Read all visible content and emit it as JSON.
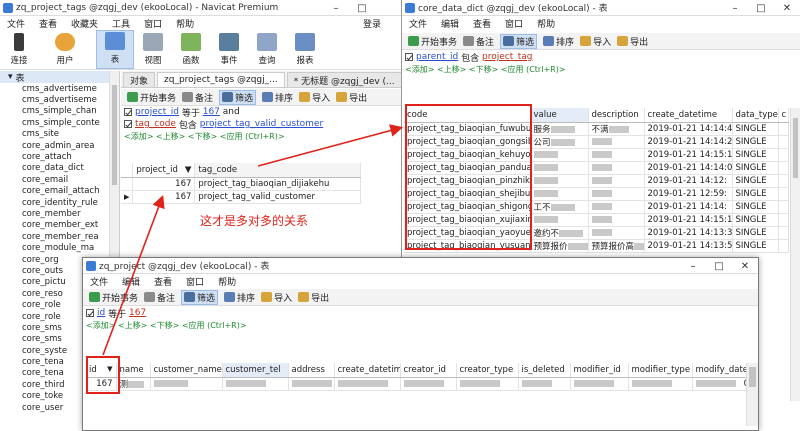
{
  "navicat": {
    "title": "zq_project_tags @zqgj_dev (ekooLocal) - Navicat Premium",
    "login": "登录",
    "menu": [
      "文件",
      "查看",
      "收藏夹",
      "工具",
      "窗口",
      "帮助"
    ],
    "tools": [
      "连接",
      "用户",
      "表",
      "视图",
      "函数",
      "事件",
      "查询",
      "报表"
    ],
    "sidebar_header": "表",
    "tree_items": [
      "cms_advertiseme",
      "cms_advertiseme",
      "cms_simple_chan",
      "cms_simple_conte",
      "cms_site",
      "core_admin_area",
      "core_attach",
      "core_data_dict",
      "core_email",
      "core_email_attach",
      "core_identity_rule",
      "core_member",
      "core_member_ext",
      "core_member_rea",
      "core_module_ma",
      "core_org",
      "core_outs",
      "core_pictu",
      "core_reso",
      "core_role",
      "core_role",
      "core_sms",
      "core_sms",
      "core_syste",
      "core_tena",
      "core_tena",
      "core_third",
      "core_toke",
      "core_user"
    ],
    "tabs": [
      "对象",
      "zq_project_tags @zqgj_...",
      "* 无标题 @zqgj_dev (..."
    ],
    "toolbar": [
      "开始事务",
      "备注",
      "筛选",
      "排序",
      "导入",
      "导出"
    ],
    "filter": {
      "field": "project_id",
      "op": "等于",
      "value": "167",
      "join": "and"
    },
    "filter2": {
      "field": "tag_code",
      "op": "包含",
      "value": "project_tag_valid_customer"
    },
    "hint": "<添加> <上移> <下移> <应用 (Ctrl+R)>",
    "columns": [
      "project_id",
      "tag_code"
    ],
    "rows": [
      [
        "167",
        "project_tag_biaoqian_dijiakehu"
      ],
      [
        "167",
        "project_tag_valid_customer"
      ]
    ],
    "annotation": "这才是多对多的关系"
  },
  "dict": {
    "title": "core_data_dict @zqgj_dev (ekooLocal) - 表",
    "menu": [
      "文件",
      "编辑",
      "查看",
      "窗口",
      "帮助"
    ],
    "toolbar": [
      "开始事务",
      "备注",
      "筛选",
      "排序",
      "导入",
      "导出"
    ],
    "filter": {
      "field": "parent_id",
      "op": "包含",
      "value": "project_tag"
    },
    "hint": "<添加> <上移> <下移> <应用 (Ctrl+R)>",
    "columns": [
      "code",
      "value",
      "description",
      "create_datetime",
      "data_type",
      "c"
    ],
    "codes": [
      "project_tag_biaoqian_fuwubumanyi",
      "project_tag_biaoqian_gongsibumanyi",
      "project_tag_biaoqian_kehuyouwenti",
      "project_tag_biaoqian_panduanbuzhun",
      "project_tag_biaoqian_pinzhikehu",
      "project_tag_biaoqian_shejibumanyi",
      "project_tag_biaoqian_shigongbuman",
      "project_tag_biaoqian_xujiaxinxi",
      "project_tag_biaoqian_yaoyuebujishi",
      "project_tag_biaoqian_yusuanbaojiag"
    ],
    "values": [
      "服务",
      "公司",
      "",
      "",
      "",
      "",
      "工不",
      "",
      "邀约不",
      "预算报价"
    ],
    "descriptions": [
      "不满",
      "",
      "",
      "",
      "",
      "",
      "",
      "",
      "",
      "预算报价高"
    ],
    "dates": [
      "2019-01-21 14:14:43",
      "2019-01-21 14:14:22",
      "2019-01-21 14:15:12",
      "2019-01-21 14:14:00",
      "2019-01-21 14:12:",
      "2019-01-21 12:59:",
      "2019-01-21 14:14:",
      "2019-01-21 14:15:18",
      "2019-01-21 14:13:32",
      "2019-01-21 14:13:52"
    ],
    "types": [
      "SINGLE",
      "SINGLE",
      "SINGLE",
      "SINGLE",
      "SINGLE",
      "SINGLE",
      "SINGLE",
      "SINGLE",
      "SINGLE",
      "SINGLE"
    ]
  },
  "proj": {
    "title": "zq_project @zqgj_dev (ekooLocal) - 表",
    "menu": [
      "文件",
      "编辑",
      "查看",
      "窗口",
      "帮助"
    ],
    "toolbar": [
      "开始事务",
      "备注",
      "筛选",
      "排序",
      "导入",
      "导出"
    ],
    "filter": {
      "field": "id",
      "op": "等于",
      "value": "167"
    },
    "hint": "<添加> <上移> <下移> <应用 (Ctrl+R)>",
    "columns": [
      "id",
      "name",
      "customer_name",
      "customer_tel",
      "address",
      "create_datetime",
      "creator_id",
      "creator_type",
      "is_deleted",
      "modifier_id",
      "modifier_type",
      "modify_datetim"
    ],
    "row_id": "167",
    "row_name": "测",
    "row_end": "02"
  },
  "colors": {
    "accent": "#cfe0f5",
    "red": "#e0221b",
    "field": "#2a4fd0",
    "hint": "#1e8a2e"
  }
}
